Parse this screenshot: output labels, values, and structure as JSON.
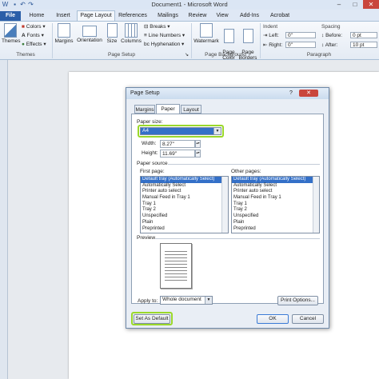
{
  "app": {
    "title": "Document1 - Microsoft Word"
  },
  "window_controls": {
    "minimize": "–",
    "maximize": "□",
    "close": "✕"
  },
  "ribbon_tabs": [
    "File",
    "Home",
    "Insert",
    "Page Layout",
    "References",
    "Mailings",
    "Review",
    "View",
    "Add-Ins",
    "Acrobat"
  ],
  "active_tab": "Page Layout",
  "ribbon": {
    "themes": {
      "label": "Themes",
      "colors": "Colors",
      "fonts": "Fonts",
      "effects": "Effects",
      "group": "Themes"
    },
    "page_setup": {
      "margins": "Margins",
      "orientation": "Orientation",
      "size": "Size",
      "columns": "Columns",
      "breaks": "Breaks",
      "line_numbers": "Line Numbers",
      "hyphenation": "Hyphenation",
      "group": "Page Setup"
    },
    "page_background": {
      "watermark": "Watermark",
      "page_color": "Page\nColor",
      "page_borders": "Page\nBorders",
      "group": "Page Background"
    },
    "paragraph": {
      "indent": "Indent",
      "left_label": "Left:",
      "left_value": "0\"",
      "right_label": "Right:",
      "right_value": "0\"",
      "spacing": "Spacing",
      "before_label": "Before:",
      "before_value": "0 pt",
      "after_label": "After:",
      "after_value": "10 pt",
      "group": "Paragraph"
    }
  },
  "dialog": {
    "title": "Page Setup",
    "help": "?",
    "tabs": [
      "Margins",
      "Paper",
      "Layout"
    ],
    "active_tab": "Paper",
    "paper_size_label": "Paper size:",
    "paper_size_value": "A4",
    "width_label": "Width:",
    "width_value": "8.27\"",
    "height_label": "Height:",
    "height_value": "11.69\"",
    "paper_source_label": "Paper source",
    "first_page_label": "First page:",
    "other_pages_label": "Other pages:",
    "first_page_items": [
      "Default tray (Automatically Select)",
      "Automatically Select",
      "Printer auto select",
      "Manual Feed in Tray 1",
      "Tray 1",
      "Tray 2",
      "Unspecified",
      "Plain",
      "Preprinted"
    ],
    "other_pages_items": [
      "Default tray (Automatically Select)",
      "Automatically Select",
      "Printer auto select",
      "Manual Feed in Tray 1",
      "Tray 1",
      "Tray 2",
      "Unspecified",
      "Plain",
      "Preprinted"
    ],
    "preview_label": "Preview",
    "apply_to_label": "Apply to:",
    "apply_to_value": "Whole document",
    "print_options": "Print Options...",
    "set_as_default": "Set As Default",
    "ok": "OK",
    "cancel": "Cancel"
  },
  "colors": {
    "file_tab": "#2a5ea8",
    "highlight": "#9ad82a",
    "selection": "#3470c8"
  }
}
